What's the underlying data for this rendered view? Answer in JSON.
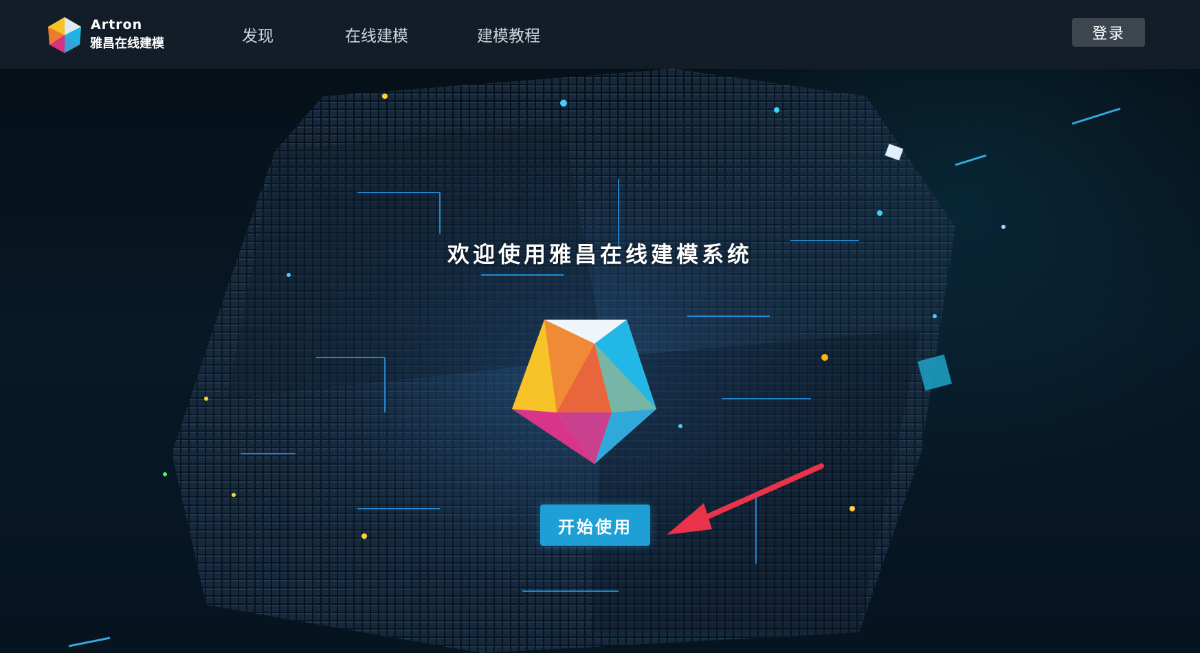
{
  "brand": {
    "name_en": "Artron",
    "name_cn": "雅昌在线建模"
  },
  "nav": {
    "items": [
      "发现",
      "在线建模",
      "建模教程"
    ]
  },
  "header": {
    "login_label": "登录"
  },
  "hero": {
    "title": "欢迎使用雅昌在线建模系统",
    "start_label": "开始使用"
  },
  "colors": {
    "navbar_bg": "#131d28",
    "accent_button": "#1e9fd6",
    "annotation_arrow": "#e8334a"
  }
}
